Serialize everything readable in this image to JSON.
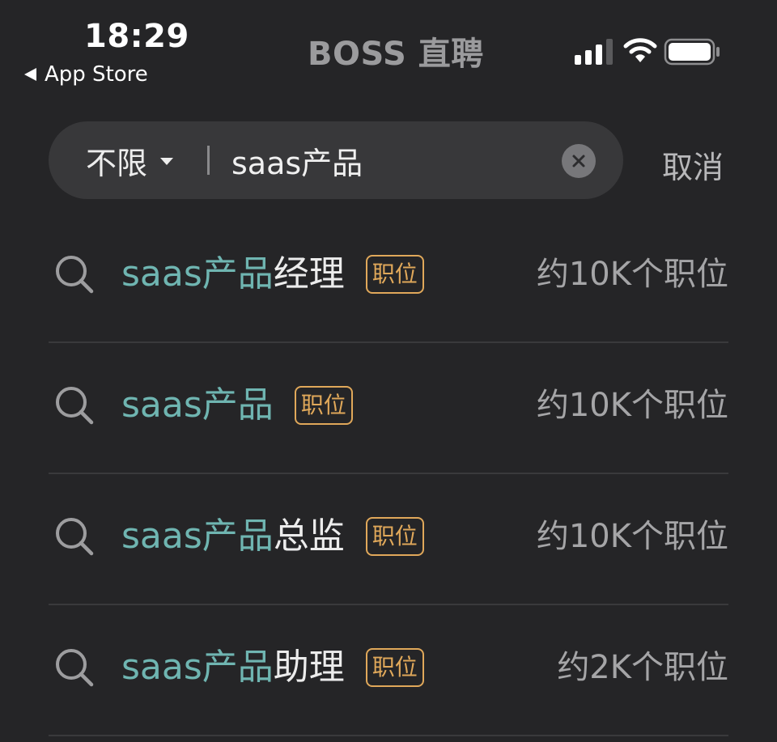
{
  "status_bar": {
    "time": "18:29",
    "back_label": "App Store",
    "app_title": "BOSS 直聘",
    "icons": [
      "signal-icon",
      "wifi-icon",
      "battery-icon"
    ]
  },
  "search": {
    "filter_label": "不限",
    "query": "saas产品",
    "clear_icon": "clear-icon",
    "cancel_label": "取消"
  },
  "suggestions": [
    {
      "match": "saas产品",
      "suffix": "经理",
      "tag": "职位",
      "count": "约10K个职位"
    },
    {
      "match": "saas产品",
      "suffix": "",
      "tag": "职位",
      "count": "约10K个职位"
    },
    {
      "match": "saas产品",
      "suffix": "总监",
      "tag": "职位",
      "count": "约10K个职位"
    },
    {
      "match": "saas产品",
      "suffix": "助理",
      "tag": "职位",
      "count": "约2K个职位"
    }
  ],
  "colors": {
    "background": "#252527",
    "search_field": "#38383a",
    "highlight": "#6fb5b1",
    "tag": "#e0a85a",
    "muted_text": "#a5a5a7"
  }
}
